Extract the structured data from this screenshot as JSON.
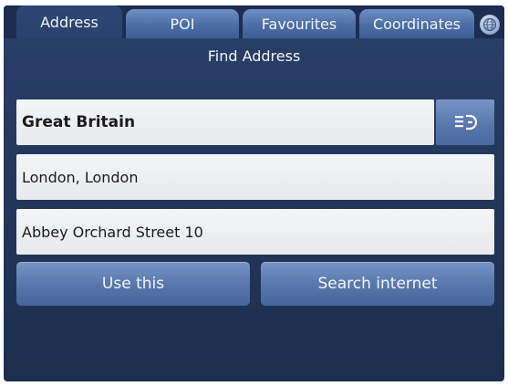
{
  "tabs": [
    {
      "label": "Address",
      "active": true
    },
    {
      "label": "POI",
      "active": false
    },
    {
      "label": "Favourites",
      "active": false
    },
    {
      "label": "Coordinates",
      "active": false
    }
  ],
  "globe_button": {
    "icon": "globe-icon"
  },
  "page_title": "Find Address",
  "form": {
    "country": "Great Britain",
    "city": "London, London",
    "street": "Abbey Orchard Street 10",
    "country_button_icon": "select-list-icon"
  },
  "actions": {
    "use_this": "Use this",
    "search_internet": "Search internet"
  },
  "colors": {
    "background": "#223659",
    "tab": "#4c6ea6",
    "field": "#eeeff2",
    "button": "#5676ab"
  }
}
